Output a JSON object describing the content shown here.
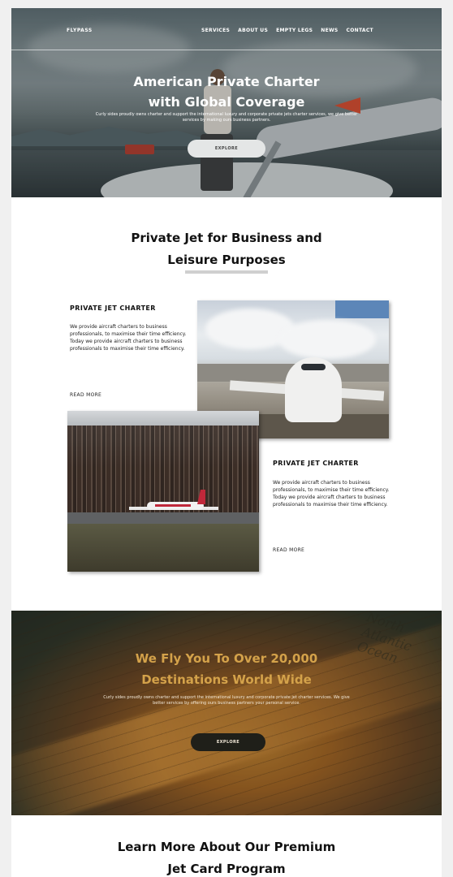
{
  "nav": {
    "brand": "FLYPASS",
    "links": [
      "SERVICES",
      "ABOUT US",
      "EMPTY LEGS",
      "NEWS",
      "CONTACT"
    ]
  },
  "hero": {
    "title_line1": "American Private Charter",
    "title_line2": "with Global Coverage",
    "subtitle": "Curly sides proudly owns charter and support the international luxury and corporate private jets charter services, we give better services by making ours business partners.",
    "button": "EXPLORE"
  },
  "section2": {
    "title_line1": "Private Jet for Business and",
    "title_line2": "Leisure Purposes",
    "card1": {
      "heading": "PRIVATE JET CHARTER",
      "text": "We provide aircraft charters to business professionals, to maximise their time efficiency. Today we provide aircraft charters to business professionals to maximise their time efficiency.",
      "link": "READ MORE"
    },
    "card2": {
      "heading": "PRIVATE JET CHARTER",
      "text": "We provide aircraft charters to business professionals, to maximise their time efficiency. Today we provide aircraft charters to business professionals to maximise their time efficiency.",
      "link": "READ MORE"
    }
  },
  "section3": {
    "title_line1": "We Fly You To Over 20,000",
    "title_line2": "Destinations World Wide",
    "subtitle": "Curly sides proudly owns charter and support the international luxury and corporate private jet charter services. We give better services by offering ours business partners your personal service.",
    "button": "EXPLORE",
    "map_text": "North Atlantic Ocean"
  },
  "section4": {
    "title_line1": "Learn More About Our Premium",
    "title_line2": "Jet Card Program"
  }
}
